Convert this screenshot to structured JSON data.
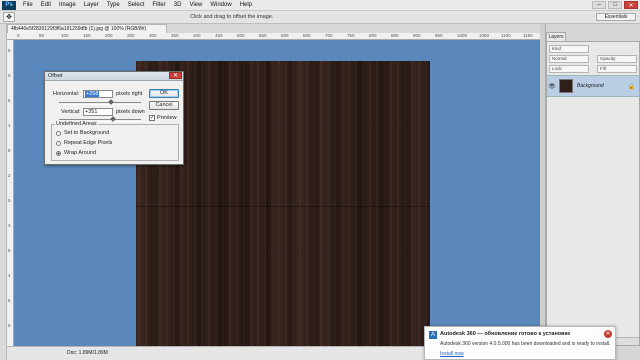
{
  "app": {
    "logo": "Ps"
  },
  "menu": [
    "File",
    "Edit",
    "Image",
    "Layer",
    "Type",
    "Select",
    "Filter",
    "3D",
    "View",
    "Window",
    "Help"
  ],
  "window_controls": {
    "minimize": "–",
    "maximize": "□",
    "close": "✕"
  },
  "options_bar": {
    "hint": "Click and drag to offset the image.",
    "workspace": "Essentials"
  },
  "document": {
    "tab_title": "4fb440e5f2830129f3f6a191259dfb (1).jpg @ 100% (RGB/8#)",
    "status": "Doc: 1.89M/1.89M"
  },
  "rulers": {
    "top": [
      "0",
      "50",
      "100",
      "150",
      "200",
      "250",
      "300",
      "350",
      "400",
      "450",
      "500",
      "550",
      "600",
      "650",
      "700",
      "750",
      "800",
      "850",
      "900",
      "950",
      "1000",
      "1050",
      "1100",
      "1150"
    ],
    "left": [
      "5",
      "0",
      "5",
      "1",
      "5",
      "2",
      "5",
      "3",
      "5",
      "4",
      "5",
      "5"
    ]
  },
  "layers_panel": {
    "tab": "Layers",
    "kind_label": "Kind",
    "blend_mode": "Normal",
    "opacity_label": "Opacity:",
    "lock_label": "Lock:",
    "fill_label": "Fill:",
    "layer_name": "Background"
  },
  "dialog": {
    "title": "Offset",
    "horizontal_label": "Horizontal:",
    "horizontal_value": "+258",
    "horizontal_unit": "pixels right",
    "vertical_label": "Vertical:",
    "vertical_value": "+351",
    "vertical_unit": "pixels down",
    "ok": "OK",
    "cancel": "Cancel",
    "preview_label": "Preview",
    "preview_checked": true,
    "undefined_areas_title": "Undefined Areas",
    "options": [
      "Set to Background",
      "Repeat Edge Pixels",
      "Wrap Around"
    ],
    "selected_option": "Wrap Around"
  },
  "notification": {
    "title": "Autodesk 360 — обновление готово к установке",
    "body": "Autodesk 360 version 4.0.5.000 has been downloaded and is ready to install.",
    "link": "Install now",
    "close": "✕",
    "icon": "A"
  }
}
